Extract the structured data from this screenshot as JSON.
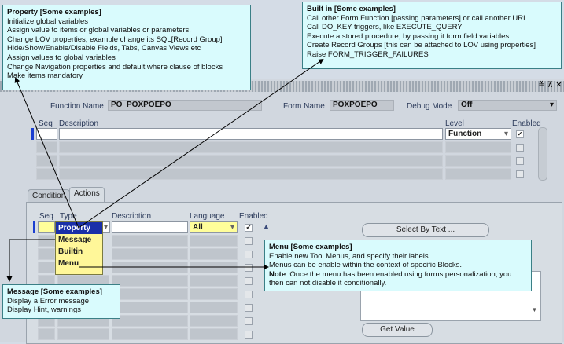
{
  "window": {
    "function_name_label": "Function Name",
    "function_name_value": "PO_POXPOEPO",
    "form_name_label": "Form Name",
    "form_name_value": "POXPOEPO",
    "debug_mode_label": "Debug Mode",
    "debug_mode_value": "Off",
    "title_buttons": [
      "≚",
      "⊼",
      "✕"
    ]
  },
  "rules": {
    "headers": {
      "seq": "Seq",
      "description": "Description",
      "level": "Level",
      "enabled": "Enabled"
    },
    "level_value": "Function",
    "enabled_check": "✔"
  },
  "tabs": [
    "Condition",
    "Actions"
  ],
  "actions": {
    "headers": {
      "seq": "Seq",
      "type": "Type",
      "description": "Description",
      "language": "Language",
      "enabled": "Enabled"
    },
    "type_options": [
      "Property",
      "Message",
      "Builtin",
      "Menu"
    ],
    "language_value": "All",
    "enabled_check": "✔",
    "select_by_text": "Select By Text ...",
    "get_value": "Get Value"
  },
  "callouts": {
    "property": {
      "title": "Property [Some examples]",
      "lines": [
        "Initialize global variables",
        "Assign value to items or global variables or parameters.",
        "Change LOV properties, example change its SQL[Record Group]",
        "Hide/Show/Enable/Disable Fields, Tabs, Canvas Views etc",
        "Assign values to global variables",
        "Change Navigation properties and default where clause of blocks",
        "Make items mandatory"
      ]
    },
    "builtin": {
      "title": "Built in [Some examples]",
      "lines": [
        "Call other Form Function [passing parameters] or call another URL",
        "Call DO_KEY triggers, like EXECUTE_QUERY",
        "Execute a stored procedure, by passing it form field variables",
        "Create Record Groups [this can be attached to LOV using properties]",
        "Raise FORM_TRIGGER_FAILURES"
      ]
    },
    "menu": {
      "title": "Menu [Some examples]",
      "lines": [
        "Enable new Tool Menus, and specify their labels",
        "Menus can be enable within the context of specific Blocks."
      ],
      "note_label": "Note",
      "note_text": ": Once the menu has been enabled using forms personalization, you then can not disable it conditionally."
    },
    "message": {
      "title": "Message [Some examples]",
      "lines": [
        "Display a Error message",
        "Display Hint, warnings"
      ]
    }
  },
  "colors": {
    "callout_bg": "#d9fbfd",
    "selected_blue": "#1a2fa8",
    "yellow_field": "#fffe9a"
  }
}
